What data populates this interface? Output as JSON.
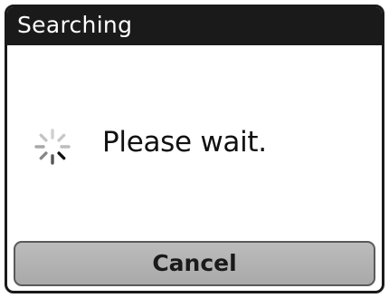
{
  "dialog": {
    "title": "Searching",
    "message": "Please wait.",
    "spinner_icon": "loading-spinner-icon",
    "cancel_label": "Cancel"
  }
}
